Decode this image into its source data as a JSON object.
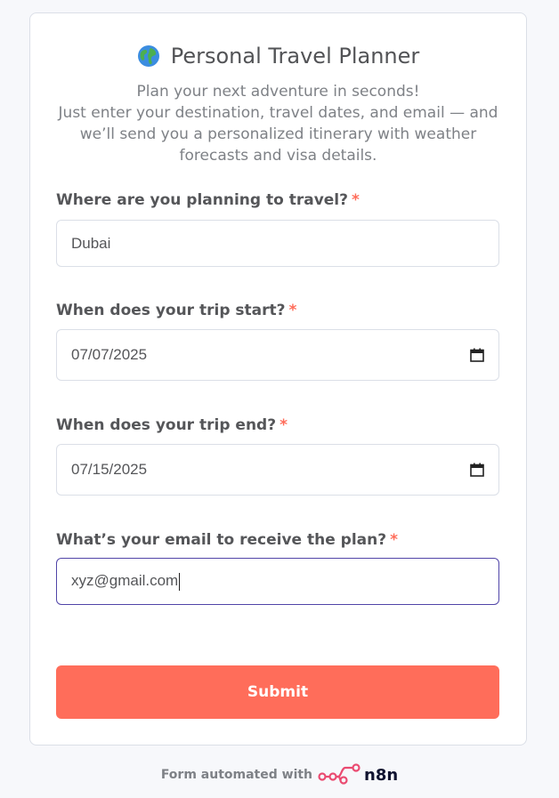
{
  "form": {
    "title": "Personal Travel Planner",
    "description_lines": [
      "Plan your next adventure in seconds!",
      "Just enter your destination, travel dates, and email — and",
      "we’ll send you a personalized itinerary with weather",
      "forecasts and visa details."
    ],
    "fields": [
      {
        "label": "Where are you planning to travel?",
        "required_mark": "*",
        "value": "Dubai",
        "type": "text"
      },
      {
        "label": "When does your trip start?",
        "required_mark": "*",
        "value": "07/07/2025",
        "type": "date"
      },
      {
        "label": "When does your trip end?",
        "required_mark": "*",
        "value": "07/15/2025",
        "type": "date"
      },
      {
        "label": "What’s your email to receive the plan?",
        "required_mark": "*",
        "value": "xyz@gmail.com",
        "type": "email"
      }
    ],
    "submit_label": "Submit"
  },
  "footer": {
    "text": "Form automated with",
    "brand": "n8n"
  },
  "colors": {
    "accent": "#ff6d5a",
    "focus_border": "#5145a8",
    "background": "#f7f8fb"
  },
  "icons": {
    "title_icon": "globe-icon",
    "date_icon": "calendar-icon",
    "brand_icon": "n8n-logo-icon"
  }
}
